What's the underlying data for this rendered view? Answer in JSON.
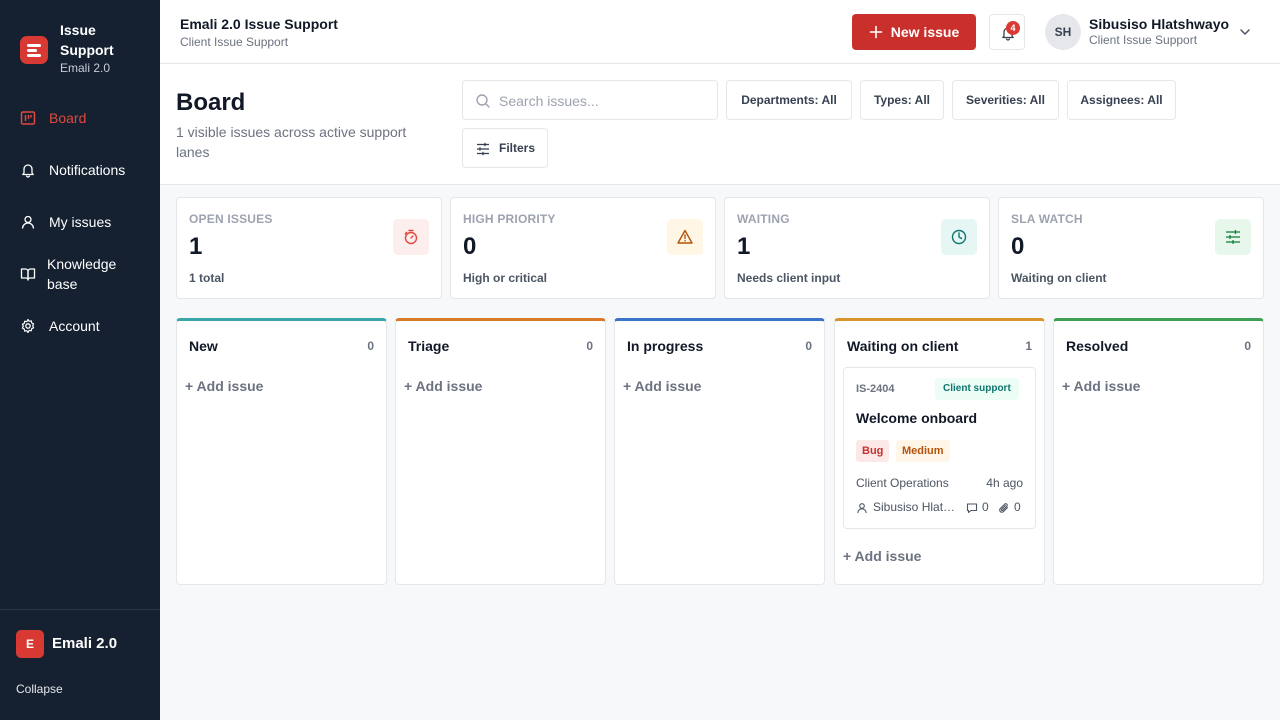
{
  "sidebar": {
    "brand_title": "Issue Support",
    "brand_subtitle": "Emali 2.0",
    "nav": [
      {
        "label": "Board",
        "icon": "board-icon",
        "active": true
      },
      {
        "label": "Notifications",
        "icon": "bell-icon",
        "active": false
      },
      {
        "label": "My issues",
        "icon": "user-icon",
        "active": false
      },
      {
        "label": "Knowledge base",
        "icon": "book-icon",
        "active": false
      },
      {
        "label": "Account",
        "icon": "gear-icon",
        "active": false
      }
    ],
    "workspace_initial": "E",
    "workspace_name": "Emali 2.0",
    "collapse_label": "Collapse"
  },
  "header": {
    "title": "Emali 2.0 Issue Support",
    "subtitle": "Client Issue Support",
    "new_issue_label": "New issue",
    "notification_count": "4",
    "user_initials": "SH",
    "user_name": "Sibusiso Hlatshwayo",
    "user_role": "Client Issue Support"
  },
  "board": {
    "title": "Board",
    "description": "1 visible issues across active support lanes",
    "search_placeholder": "Search issues...",
    "search_value": "",
    "filters": {
      "departments": "Departments: All",
      "types": "Types: All",
      "severities": "Severities: All",
      "assignees": "Assignees: All",
      "filters_button": "Filters"
    }
  },
  "stats": [
    {
      "label": "OPEN ISSUES",
      "value": "1",
      "note": "1 total",
      "icon": "timer-icon",
      "color": "#e0493f",
      "bg": "#fdeeee"
    },
    {
      "label": "HIGH PRIORITY",
      "value": "0",
      "note": "High or critical",
      "icon": "warning-icon",
      "color": "#b45309",
      "bg": "#fff6e5"
    },
    {
      "label": "WAITING",
      "value": "1",
      "note": "Needs client input",
      "icon": "clock-icon",
      "color": "#0f766e",
      "bg": "#e6f6f5"
    },
    {
      "label": "SLA WATCH",
      "value": "0",
      "note": "Waiting on client",
      "icon": "sliders-icon",
      "color": "#15803d",
      "bg": "#e8f7ec"
    }
  ],
  "columns": [
    {
      "title": "New",
      "count": "0",
      "accent": "#3aa6a8"
    },
    {
      "title": "Triage",
      "count": "0",
      "accent": "#d97a2b"
    },
    {
      "title": "In progress",
      "count": "0",
      "accent": "#3b73c8"
    },
    {
      "title": "Waiting on client",
      "count": "1",
      "accent": "#d9952b"
    },
    {
      "title": "Resolved",
      "count": "0",
      "accent": "#3f9f54"
    }
  ],
  "add_issue_label": "+ Add issue",
  "card": {
    "id": "IS-2404",
    "chip": "Client support",
    "title": "Welcome onboard",
    "type_tag": "Bug",
    "severity_tag": "Medium",
    "department": "Client Operations",
    "time": "4h ago",
    "assignee": "Sibusiso Hlatshwayo",
    "comments": "0",
    "attachments": "0"
  }
}
